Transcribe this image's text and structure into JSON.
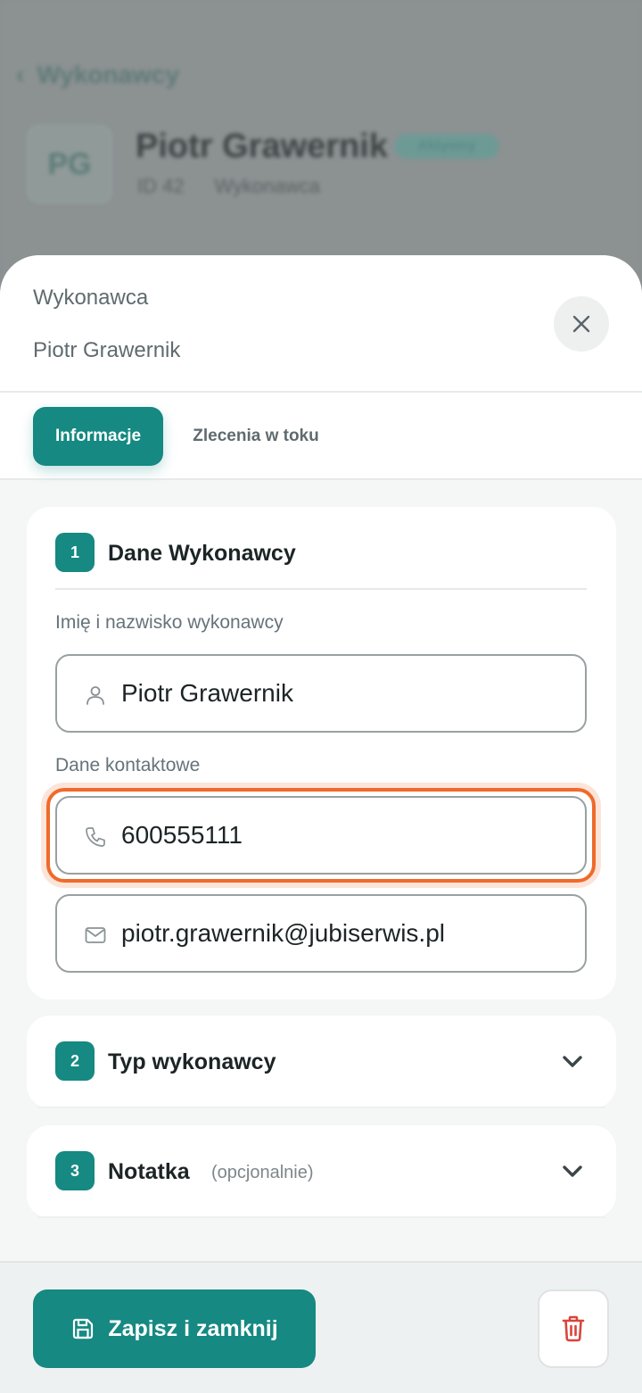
{
  "background": {
    "back_label": "Wykonawcy",
    "avatar_initials": "PG",
    "name": "Piotr Grawernik",
    "badge": "Aktywny",
    "meta": [
      "ID 42",
      "Wykonawca"
    ]
  },
  "sheet": {
    "label": "Wykonawca",
    "name": "Piotr Grawernik"
  },
  "tabs": [
    {
      "label": "Informacje",
      "active": true
    },
    {
      "label": "Zlecenia w toku",
      "active": false
    }
  ],
  "section1": {
    "number": "1",
    "title": "Dane Wykonawcy",
    "name_label": "Imię i nazwisko wykonawcy",
    "name_value": "Piotr Grawernik",
    "contact_label": "Dane kontaktowe",
    "phone_value": "600555111",
    "email_value": "piotr.grawernik@jubiserwis.pl"
  },
  "section2": {
    "number": "2",
    "title": "Typ wykonawcy"
  },
  "section3": {
    "number": "3",
    "title": "Notatka",
    "optional": "(opcjonalnie)"
  },
  "footer": {
    "save_label": "Zapisz i zamknij"
  },
  "colors": {
    "accent": "#158982",
    "highlight": "#ef6a2b",
    "danger": "#d9453b"
  }
}
